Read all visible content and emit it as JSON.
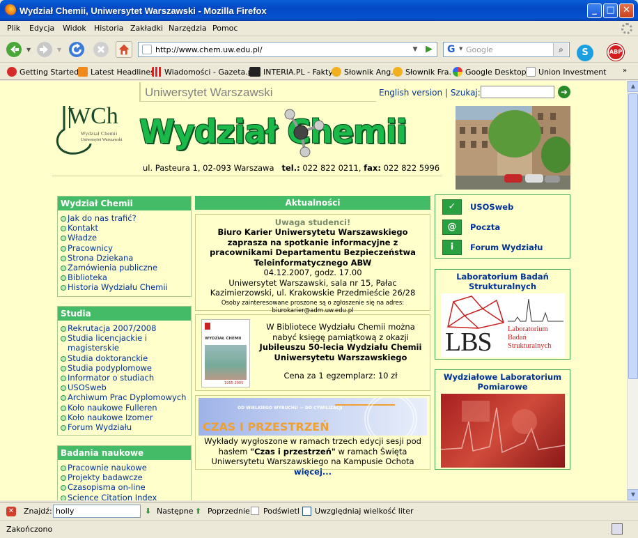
{
  "window": {
    "title": "Wydział Chemii, Uniwersytet Warszawski - Mozilla Firefox",
    "minimize": "_",
    "maximize": "□",
    "close": "✕"
  },
  "menu": [
    "Plik",
    "Edycja",
    "Widok",
    "Historia",
    "Zakładki",
    "Narzędzia",
    "Pomoc"
  ],
  "nav": {
    "url": "http://www.chem.uw.edu.pl/",
    "search_placeholder": "Google",
    "skype": "S",
    "abp": "ABP"
  },
  "bookmarks": [
    "Getting Started",
    "Latest Headlines",
    "Wiadomości - Gazeta.pl",
    "INTERIA.PL - Fakty",
    "Słownik Ang.",
    "Słownik Fra.",
    "Google Desktop",
    "Union Investment"
  ],
  "header": {
    "university": "Uniwersytet Warszawski",
    "english": "English version",
    "separator": "|",
    "search_label": "Szukaj:",
    "logo_text": "WCh",
    "logo_sub1": "Wydział Chemii",
    "logo_sub2": "Uniwersytet Warszawski",
    "title": "Wydział Chemii",
    "address": "ul. Pasteura 1, 02-093 Warszawa",
    "tel_label": "tel.:",
    "tel": "022 822 0211,",
    "fax_label": "fax:",
    "fax": "022 822 5996"
  },
  "sections": {
    "wydzial": {
      "title": "Wydział Chemii",
      "items": [
        "Jak do nas trafić?",
        "Kontakt",
        "Władze",
        "Pracownicy",
        "Strona Dziekana",
        "Zamówienia publiczne",
        "Biblioteka",
        "Historia Wydziału Chemii"
      ]
    },
    "studia": {
      "title": "Studia",
      "items": [
        "Rekrutacja 2007/2008",
        "Studia licencjackie i",
        "magisterskie",
        "Studia doktoranckie",
        "Studia podyplomowe",
        "Informator o studiach",
        "USOSweb",
        "Archiwum Prac Dyplomowych",
        "Koło naukowe Fulleren",
        "Koło naukowe Izomer",
        "Forum Wydziału"
      ]
    },
    "badania": {
      "title": "Badania naukowe",
      "items": [
        "Pracownie naukowe",
        "Projekty badawcze",
        "Czasopisma on-line",
        "Science Citation Index"
      ]
    }
  },
  "news": {
    "title": "Aktualności",
    "item1": {
      "heading": "Uwaga studenci!",
      "bold": "Biuro Karier Uniwersytetu Warszawskiego zaprasza na spotkanie informacyjne z pracownikami Departamentu Bezpieczeństwa Teleinformatycznego ABW",
      "date": "04.12.2007, godz. 17.00",
      "place": "Uniwersytet Warszawski, sala nr 15, Pałac Kazimierzowski, ul. Krakowskie Przedmieście 26/28",
      "small": "Osoby zainteresowane proszone są o zgłoszenie się na adres:",
      "email": "biurokarier@adm.uw.edu.pl"
    },
    "item2": {
      "text": "W Bibliotece Wydziału Chemii można nabyć księgę pamiątkową z okazji",
      "bold": "Jubileuszu 50-lecia Wydziału Chemii Uniwersytetu Warszawskiego",
      "price": "Cena za 1 egzemplarz: 10 zł",
      "book_title": "WYDZIAŁ CHEMII",
      "book_years": "1955-2005"
    },
    "item3": {
      "banner_small": "OD WIELKIEGO WYBUCHU — DO CYWILIZACJI",
      "banner_big": "CZAS I PRZESTRZEŃ",
      "text1": "Wykłady wygłoszone w ramach trzech edycji sesji pod hasłem",
      "bold": "\"Czas i przestrzeń\"",
      "text2": "w ramach Święta Uniwersytetu Warszawskiego na Kampusie Ochota",
      "more": "więcej..."
    }
  },
  "right": {
    "links": [
      {
        "label": "USOSweb",
        "icon": "✓"
      },
      {
        "label": "Poczta",
        "icon": "@"
      },
      {
        "label": "Forum Wydziału",
        "icon": "i"
      }
    ],
    "lbs_title": "Laboratorium Badań Strukturalnych",
    "lbs_logo": "LBS",
    "lbs_logo_sub": "Laboratorium Badań Strukturalnych",
    "wlp_title": "Wydziałowe Laboratorium Pomiarowe"
  },
  "findbar": {
    "label": "Znajdź:",
    "value": "holly",
    "next": "Następne",
    "prev": "Poprzednie",
    "highlight": "Podświetl",
    "matchcase": "Uwzględniaj wielkość liter"
  },
  "status": "Zakończono",
  "colors": {
    "green_header": "#44bb66",
    "link": "#003399",
    "page_bg": "#ffffcc"
  }
}
